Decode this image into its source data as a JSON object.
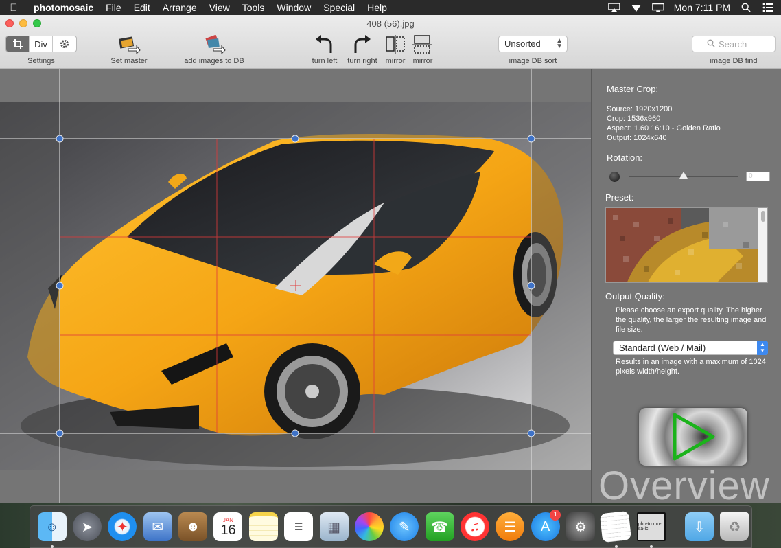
{
  "menubar": {
    "app_name": "photomosaic",
    "items": [
      "File",
      "Edit",
      "Arrange",
      "View",
      "Tools",
      "Window",
      "Special",
      "Help"
    ],
    "clock": "Mon 7:11 PM"
  },
  "window": {
    "title": "408 (56).jpg"
  },
  "toolbar": {
    "seg_div_label": "Div",
    "settings_label": "Settings",
    "set_master_label": "Set master",
    "add_images_label": "add images to DB",
    "turn_left_label": "turn left",
    "turn_right_label": "turn right",
    "mirror_h_label": "mirror",
    "mirror_v_label": "mirror",
    "sort_value": "Unsorted",
    "sort_label": "image DB sort",
    "search_placeholder": "Search",
    "find_label": "image DB find"
  },
  "panel": {
    "master_crop_heading": "Master Crop:",
    "source": "Source: 1920x1200",
    "crop": "Crop: 1536x960",
    "aspect": "Aspect: 1.60 16:10 - Golden Ratio",
    "output": "Output: 1024x640",
    "rotation_heading": "Rotation:",
    "rotation_value": "0",
    "preset_heading": "Preset:",
    "quality_heading": "Output Quality:",
    "quality_help": "Please choose an export quality. The higher the quality, the larger the resulting image and file size.",
    "quality_value": "Standard (Web / Mail)",
    "quality_result": "Results in an image with a maximum of 1024 pixels width/height.",
    "overview_label": "Overview"
  },
  "dock": {
    "calendar_month": "JAN",
    "calendar_day": "16",
    "appstore_badge": "1",
    "mosaic_caption": "pho-to mo-sa-ic"
  },
  "colors": {
    "accent_blue": "#3d89f0",
    "crop_handle": "#3f73c8",
    "guide_red": "#e03a3a",
    "car_orange": "#f5a515"
  }
}
